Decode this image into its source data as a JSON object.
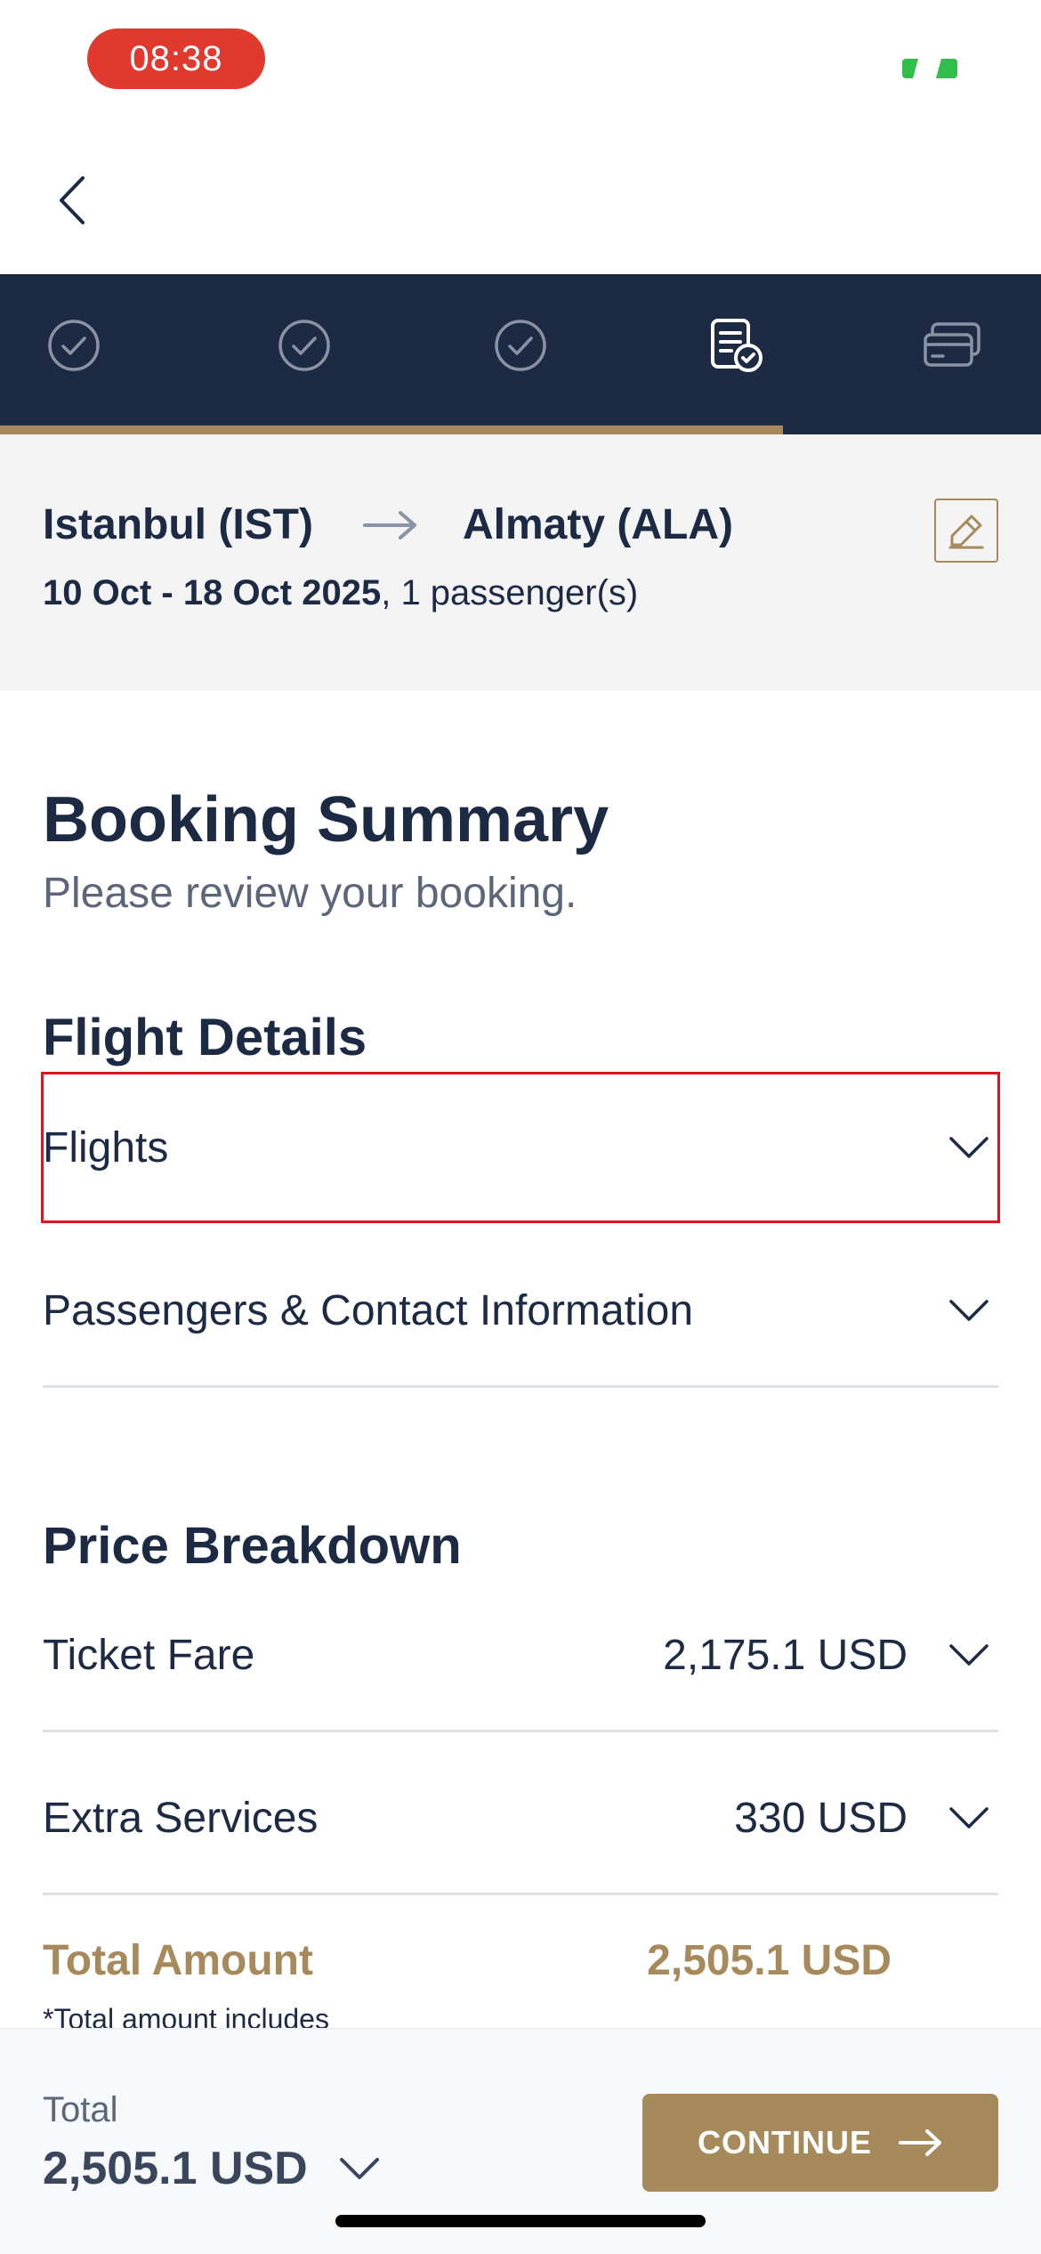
{
  "status": {
    "time": "08:38"
  },
  "route": {
    "origin": "Istanbul (IST)",
    "destination": "Almaty (ALA)",
    "dates": "10 Oct - 18 Oct 2025",
    "passengers": ", 1 passenger(s)"
  },
  "page": {
    "title": "Booking Summary",
    "subtitle": "Please review your booking."
  },
  "flight_details": {
    "title": "Flight Details",
    "items": [
      {
        "label": "Flights"
      },
      {
        "label": "Passengers & Contact Information"
      }
    ]
  },
  "price_breakdown": {
    "title": "Price Breakdown",
    "items": [
      {
        "label": "Ticket Fare",
        "amount": "2,175.1 USD"
      },
      {
        "label": "Extra Services",
        "amount": "330 USD"
      }
    ],
    "total_label": "Total Amount",
    "total_amount": "2,505.1 USD",
    "total_note": "*Total amount includes"
  },
  "bottom_bar": {
    "label": "Total",
    "amount": "2,505.1 USD",
    "continue_label": "CONTINUE"
  },
  "colors": {
    "navy": "#1c2a44",
    "gold": "#a68a5b",
    "highlight": "#e0141e"
  }
}
